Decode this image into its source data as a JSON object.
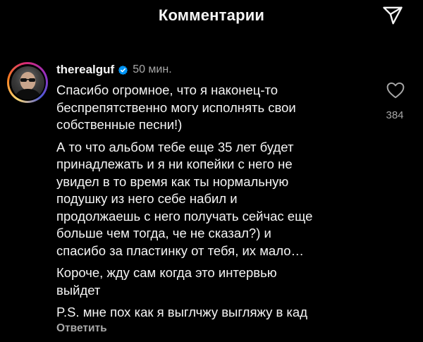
{
  "header": {
    "title": "Комментарии"
  },
  "comment": {
    "username": "therealguf",
    "time": "50 мин.",
    "paragraphs": [
      "Спасибо огромное, что я наконец-то\nбеспрепятственно могу исполнять свои\nсобственные песни!)",
      "А то что альбом тебе еще 35 лет будет\nпринадлежать и я ни копейки с него не\nувидел в то время как ты нормальную\nподушку из него себе набил и\nпродолжаешь с него получать сейчас еще\nбольше чем тогда, че не сказал?) и\nспасибо за пластинку от тебя, их мало…",
      "Короче, жду сам когда это интервью\nвыйдет",
      "P.S. мне пох как я выглчжу выгляжу в кад"
    ],
    "reply_label": "Ответить",
    "like_count": "384",
    "verified_color": "#0095f6"
  },
  "icons": {
    "share": "paper-plane-icon",
    "like": "heart-outline-icon",
    "verified": "verified-badge-icon"
  }
}
